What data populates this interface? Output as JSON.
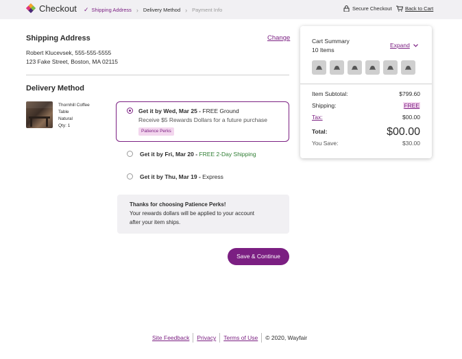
{
  "header": {
    "brand": "Checkout",
    "steps": {
      "shipping": "Shipping Address",
      "delivery": "Delivery Method",
      "payment": "Payment Info"
    },
    "secure_checkout": "Secure Checkout",
    "back_to_cart": "Back to Cart"
  },
  "shipping": {
    "heading": "Shipping Address",
    "change_label": "Change",
    "name_phone": "Robert Klucevsek, 555-555-5555",
    "address": "123 Fake Street, Boston, MA 02115"
  },
  "delivery": {
    "heading": "Delivery Method",
    "product": {
      "name_line1": "Thornhill Coffee",
      "name_line2": "Table",
      "finish": "Natural",
      "qty": "Qty: 1"
    },
    "options": [
      {
        "date": "Get it by Wed, Mar 25",
        "sep": " - ",
        "method": "FREE Ground",
        "reward": "Receive $5 Rewards Dollars for a future purchase",
        "badge": "Patience Perks",
        "selected": true
      },
      {
        "date": "Get it by Fri, Mar 20",
        "sep": " - ",
        "method": "FREE 2-Day Shipping",
        "selected": false
      },
      {
        "date": "Get it by Thu, Mar 19",
        "sep": " - ",
        "method": "Express",
        "selected": false
      }
    ],
    "notice": {
      "title": "Thanks for choosing Patience Perks!",
      "line1": "Your rewards dollars will be applied to your account",
      "line2": "after your item ships."
    },
    "save_label": "Save & Continue"
  },
  "cart": {
    "title": "Cart Summary",
    "count": "10 Items",
    "expand_label": "Expand",
    "thumbnail_count": 6,
    "rows": {
      "subtotal_label": "Item Subtotal:",
      "subtotal_value": "$799.60",
      "shipping_label": "Shipping:",
      "shipping_value": "FREE",
      "tax_label": "Tax:",
      "tax_value": "$00.00",
      "total_label": "Total:",
      "total_value": "$00.00",
      "save_label": "You Save:",
      "save_value": "$30.00"
    }
  },
  "footer": {
    "feedback": "Site Feedback",
    "privacy": "Privacy",
    "terms": "Terms of Use",
    "copyright": "© 2020, Wayfair"
  },
  "colors": {
    "accent": "#7b1f82",
    "success": "#2e7d32",
    "header_bg": "#f1f0f3",
    "badge_bg": "#f3d6ee"
  }
}
